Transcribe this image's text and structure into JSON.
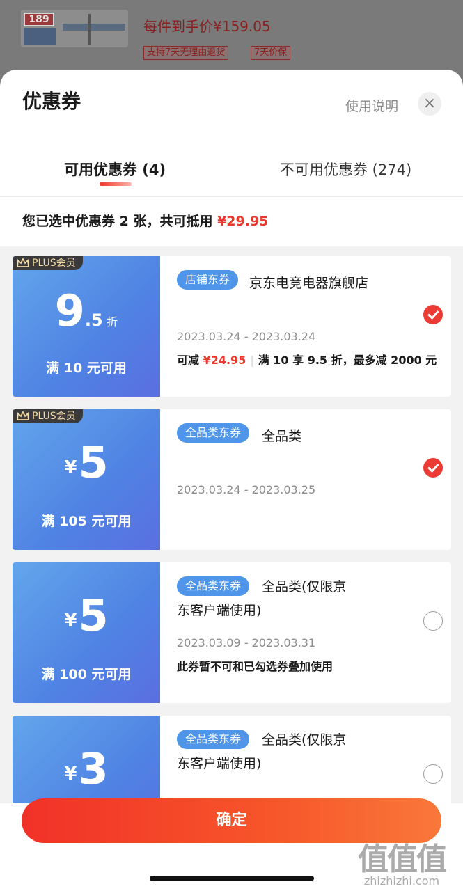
{
  "background_product": {
    "thumb_tag": "189",
    "price_text": "每件到手价¥159.05",
    "badges": [
      "支持7天无理由退货",
      "7天价保"
    ]
  },
  "sheet": {
    "title": "优惠券",
    "help_label": "使用说明",
    "close_icon": "×"
  },
  "tabs": [
    {
      "label": "可用优惠券 (4)",
      "active": true
    },
    {
      "label": "不可用优惠券 (274)",
      "active": false
    }
  ],
  "summary": {
    "text": "您已选中优惠券 2 张，共可抵用 ",
    "amount": "¥29.95"
  },
  "coupons": [
    {
      "plus_badge": "PLUS会员",
      "value_big": "9",
      "value_small": ".5",
      "value_unit": "折",
      "condition": "满 10 元可用",
      "type_tag": "店铺东券",
      "name": "京东电竞电器旗舰店",
      "date": "2023.03.24 - 2023.03.24",
      "note_prefix": "可减 ",
      "note_amount": "¥24.95",
      "note_sep": "|",
      "note_text": "满 10 享 9.5 折，最多减 2000 元",
      "selected": true
    },
    {
      "plus_badge": "PLUS会员",
      "value_yen": "¥",
      "value_big": "5",
      "condition": "满 105 元可用",
      "type_tag": "全品类东券",
      "name": "全品类",
      "date": "2023.03.24 - 2023.03.25",
      "selected": true
    },
    {
      "value_yen": "¥",
      "value_big": "5",
      "condition": "满 100 元可用",
      "type_tag": "全品类东券",
      "name": "全品类(仅限京东客户端使用)",
      "date": "2023.03.09 - 2023.03.31",
      "note_text": "此券暂不可和已勾选券叠加使用",
      "selected": false
    },
    {
      "value_yen": "¥",
      "value_big": "3",
      "type_tag": "全品类东券",
      "name": "全品类(仅限京东客户端使用)",
      "selected": false
    }
  ],
  "confirm_label": "确定",
  "watermark": {
    "logo": "值值值",
    "url": "zhizhizhi.com"
  },
  "colors": {
    "accent_red": "#e9382c",
    "coupon_blue_start": "#63a6ec",
    "coupon_blue_end": "#5b6fe0",
    "tag_blue": "#4f95ea"
  }
}
